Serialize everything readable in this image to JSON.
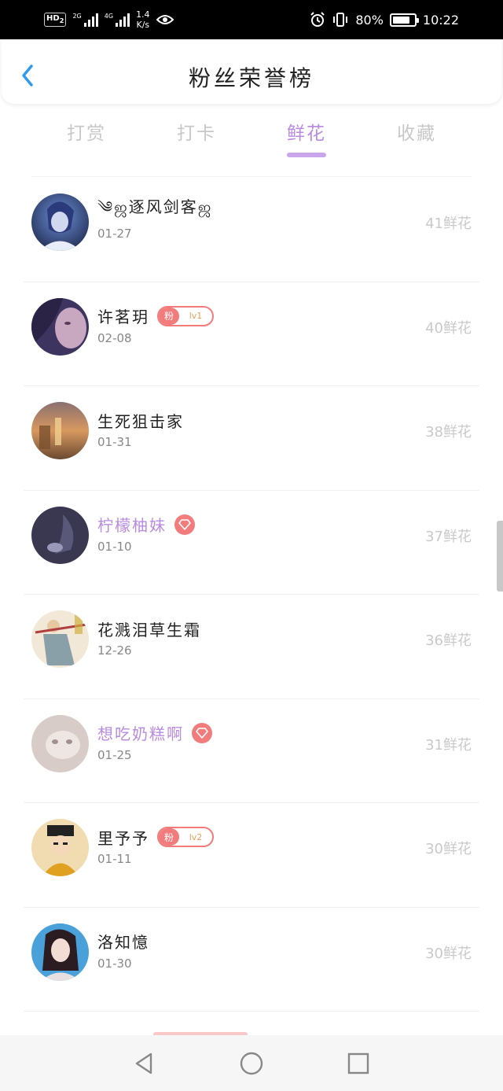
{
  "status_bar": {
    "hd": "HD",
    "hd_sub": "2",
    "sig1": "2G",
    "sig2": "4G",
    "speed_value": "1.4",
    "speed_unit": "K/s",
    "battery": "80%",
    "battery_level": 0.8,
    "time": "10:22"
  },
  "header": {
    "title": "粉丝荣誉榜"
  },
  "tabs": [
    {
      "label": "打赏",
      "active": false
    },
    {
      "label": "打卡",
      "active": false
    },
    {
      "label": "鲜花",
      "active": true
    },
    {
      "label": "收藏",
      "active": false
    }
  ],
  "list": [
    {
      "name": "༄ஜ逐风剑客ஜ",
      "date": "01-27",
      "count": "41鲜花",
      "badge": null
    },
    {
      "name": "许茗玥",
      "date": "02-08",
      "count": "40鲜花",
      "badge": {
        "fan": "粉",
        "level": "lv1"
      }
    },
    {
      "name": "生死狙击家",
      "date": "01-31",
      "count": "38鲜花",
      "badge": null
    },
    {
      "name": "柠檬柚妹",
      "date": "01-10",
      "count": "37鲜花",
      "badge": "vip"
    },
    {
      "name": "花溅泪草生霜",
      "date": "12-26",
      "count": "36鲜花",
      "badge": null
    },
    {
      "name": "想吃奶糕啊",
      "date": "01-25",
      "count": "31鲜花",
      "badge": "vip"
    },
    {
      "name": "里予予",
      "date": "01-11",
      "count": "30鲜花",
      "badge": {
        "fan": "粉",
        "level": "lv2"
      }
    },
    {
      "name": "洛知憶",
      "date": "01-30",
      "count": "30鲜花",
      "badge": null
    }
  ],
  "colors": {
    "accent": "#b98be0",
    "badge_red": "#f27b7b",
    "back_blue": "#2f9bf0",
    "count_gray": "#c9c9c9"
  },
  "icons": {
    "back": "chevron-left-icon",
    "nav_back": "triangle-back-icon",
    "nav_home": "circle-home-icon",
    "nav_recent": "square-recent-icon",
    "vip": "diamond-icon"
  }
}
